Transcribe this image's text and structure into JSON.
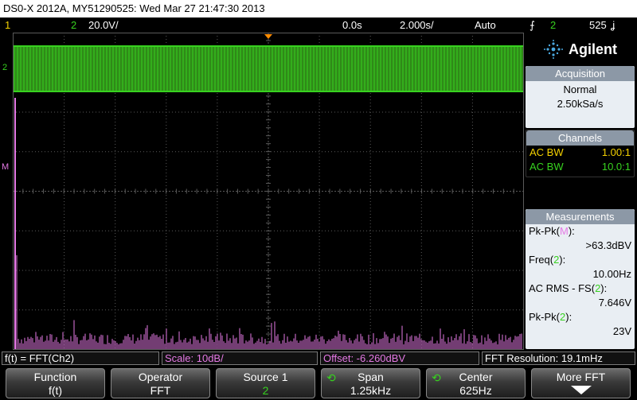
{
  "title": "DS0-X 2012A, MY51290525: Wed Mar 27 21:47:30 2013",
  "status": {
    "ch1": "1",
    "ch2": "2",
    "ch2_scale": "20.0V/",
    "time_delay": "0.0s",
    "time_base": "2.000s/",
    "trigger_mode": "Auto",
    "trigger_icon": "⨍",
    "trigger_channel": "2",
    "trigger_level": "525",
    "trigger_level_unit": "ʝ"
  },
  "brand": {
    "name": "Agilent"
  },
  "acquisition": {
    "header": "Acquisition",
    "mode": "Normal",
    "rate": "2.50kSa/s"
  },
  "channels": {
    "header": "Channels",
    "items": [
      {
        "label": "AC BW",
        "value": "1.00:1",
        "color": "#f4d100"
      },
      {
        "label": "AC BW",
        "value": "10.0:1",
        "color": "#37d21f"
      }
    ]
  },
  "measurements": {
    "header": "Measurements",
    "items": [
      {
        "name": "Pk-Pk(",
        "src": "M",
        "end": "):",
        "src_color": "#e67ae6",
        "value": ">63.3dBV"
      },
      {
        "name": "Freq(",
        "src": "2",
        "end": "):",
        "src_color": "#37d21f",
        "value": "10.00Hz"
      },
      {
        "name": "AC RMS - FS(",
        "src": "2",
        "end": "):",
        "src_color": "#37d21f",
        "value": "7.646V"
      },
      {
        "name": "Pk-Pk(",
        "src": "2",
        "end": "):",
        "src_color": "#37d21f",
        "value": "23V"
      }
    ]
  },
  "markers": {
    "ch2": "2",
    "math": "M"
  },
  "info": {
    "function": "f(t) = FFT(Ch2)",
    "scale": "Scale: 10dB/",
    "offset": "Offset: -6.260dBV",
    "resolution": "FFT Resolution: 19.1mHz"
  },
  "softkeys": [
    {
      "label": "Function",
      "value": "f(t)"
    },
    {
      "label": "Operator",
      "value": "FFT"
    },
    {
      "label": "Source 1",
      "value": "2"
    },
    {
      "label": "Span",
      "value": "1.25kHz"
    },
    {
      "label": "Center",
      "value": "625Hz"
    },
    {
      "label": "More FFT",
      "value": ""
    }
  ],
  "colors": {
    "ch1": "#f4d100",
    "ch2": "#37d21f",
    "math": "#e67ae6",
    "grid": "#5a5a5a"
  }
}
